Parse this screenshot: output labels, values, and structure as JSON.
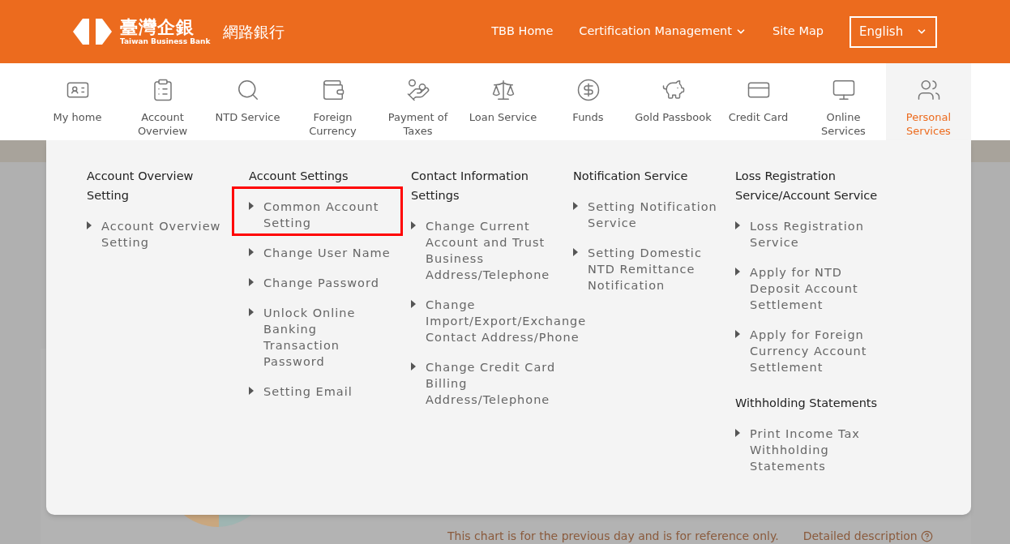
{
  "header": {
    "logo": {
      "name_zh": "臺灣企銀",
      "name_en": "Taiwan Business Bank",
      "product": "網路銀行"
    },
    "links": [
      {
        "label": "TBB Home",
        "dropdown": false
      },
      {
        "label": "Certification Management",
        "dropdown": true
      },
      {
        "label": "Site Map",
        "dropdown": false
      }
    ],
    "language": {
      "value": "English"
    }
  },
  "nav": [
    {
      "label": "My home",
      "selected": false
    },
    {
      "label": "Account Overview",
      "selected": false
    },
    {
      "label": "NTD Service",
      "selected": false
    },
    {
      "label": "Foreign Currency",
      "selected": false
    },
    {
      "label": "Payment of Taxes",
      "selected": false
    },
    {
      "label": "Loan Service",
      "selected": false
    },
    {
      "label": "Funds",
      "selected": false
    },
    {
      "label": "Gold Passbook",
      "selected": false
    },
    {
      "label": "Credit Card",
      "selected": false
    },
    {
      "label": "Online Services",
      "selected": false
    },
    {
      "label": "Personal Services",
      "selected": true
    }
  ],
  "menu": [
    {
      "sections": [
        {
          "title": "Account Overview Setting",
          "items": [
            {
              "label": "Account Overview Setting",
              "outlined": false
            }
          ]
        }
      ]
    },
    {
      "sections": [
        {
          "title": "Account Settings",
          "items": [
            {
              "label": "Common Account Setting",
              "outlined": true
            },
            {
              "label": "Change User Name",
              "outlined": false
            },
            {
              "label": "Change Password",
              "outlined": false
            },
            {
              "label": "Unlock Online Banking Transaction Password",
              "outlined": false
            },
            {
              "label": "Setting Email",
              "outlined": false
            }
          ]
        }
      ]
    },
    {
      "sections": [
        {
          "title": "Contact Information Settings",
          "items": [
            {
              "label": "Change Current Account and Trust Business Address/Telephone",
              "outlined": false
            },
            {
              "label": "Change Import/Export/Exchange Contact Address/Phone",
              "outlined": false
            },
            {
              "label": "Change Credit Card Billing Address/Telephone",
              "outlined": false
            }
          ]
        }
      ]
    },
    {
      "sections": [
        {
          "title": "Notification Service",
          "items": [
            {
              "label": "Setting Notification Service",
              "outlined": false
            },
            {
              "label": "Setting Domestic NTD Remittance Notification",
              "outlined": false
            }
          ]
        }
      ]
    },
    {
      "sections": [
        {
          "title": "Loss Registration Service/Account Service",
          "items": [
            {
              "label": "Loss Registration Service",
              "outlined": false
            },
            {
              "label": "Apply for NTD Deposit Account Settlement",
              "outlined": false
            },
            {
              "label": "Apply for Foreign Currency Account Settlement",
              "outlined": false
            }
          ]
        },
        {
          "title": "Withholding Statements",
          "items": [
            {
              "label": "Print Income Tax Withholding Statements",
              "outlined": false
            }
          ]
        }
      ]
    }
  ],
  "background": {
    "chart_note": "This chart is for the previous day and is for reference only.",
    "detail_link": "Detailed description"
  }
}
